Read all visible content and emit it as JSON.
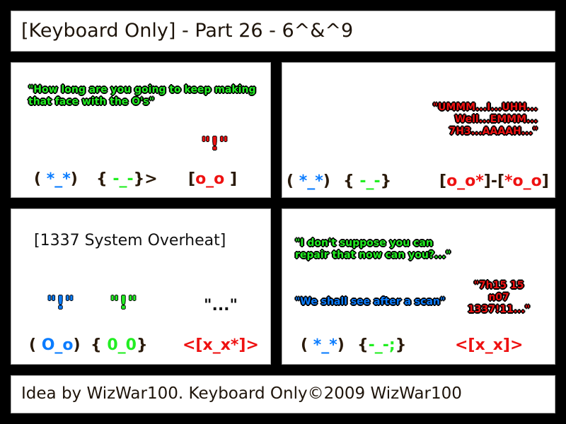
{
  "header": {
    "title": "[Keyboard Only] - Part 26 - 6^&^9"
  },
  "colors": {
    "blue": "#0a7cff",
    "green": "#22ee22",
    "red": "#ee1111",
    "ink": "#2a1a0a"
  },
  "panels": [
    {
      "speech": [
        {
          "line1": "\"How long are you going to keep making",
          "line2": "that face with the O's\"",
          "color": "green"
        }
      ],
      "reaction": "\"!\"",
      "faces": {
        "blue_face": {
          "open": "( ",
          "eyes": "*_*",
          "close": ")"
        },
        "green_face": {
          "open": "{ ",
          "eyes": "-_-",
          "close": "}>"
        },
        "red_face": {
          "open": "[",
          "eyes": "o_o",
          "close": " ]"
        }
      }
    },
    {
      "speech": [
        {
          "line1": "\"UMMM...I...UHH...",
          "line2": "Well...EMMM...",
          "line3": "7H3...AAAAH...\"",
          "color": "red"
        }
      ],
      "faces": {
        "blue_face": {
          "open": "( ",
          "eyes": "*_*",
          "close": ")"
        },
        "green_face": {
          "open": "{ ",
          "eyes": "-_-",
          "close": "}"
        },
        "red_face": {
          "left_open": "[",
          "left_eyes": "o_o*",
          "join": "]-[",
          "right_eyes": "*o_o",
          "right_close": "]"
        }
      }
    },
    {
      "caption": "[1337 System Overheat]",
      "reactions": [
        "\"!\"",
        "\"!\"",
        "\"...\""
      ],
      "faces": {
        "blue_face": {
          "open": "( ",
          "eyes": "O_o",
          "close": ")"
        },
        "green_face": {
          "open": "{ ",
          "eyes": "0_0",
          "close": "}"
        },
        "red_face": {
          "open": "<[",
          "eyes": "x_x*",
          "close": "]>"
        }
      }
    },
    {
      "speech": [
        {
          "line1": "\"I don't suppose you can",
          "line2": "repair that now can you?...\"",
          "color": "green"
        },
        {
          "line1": "\"We shall see after a scan\"",
          "color": "blue"
        },
        {
          "line1": "\"7h15 15",
          "line2": "n07",
          "line3": "1337!11...\"",
          "color": "red"
        }
      ],
      "faces": {
        "blue_face": {
          "open": "( ",
          "eyes": "*_*",
          "close": ")"
        },
        "green_face": {
          "open": "{",
          "eyes": "-_-;",
          "close": "}"
        },
        "red_face": {
          "open": "<[",
          "eyes": "x_x",
          "close": "]>"
        }
      }
    }
  ],
  "footer": {
    "credit": "Idea by WizWar100. Keyboard Only©2009 WizWar100"
  }
}
